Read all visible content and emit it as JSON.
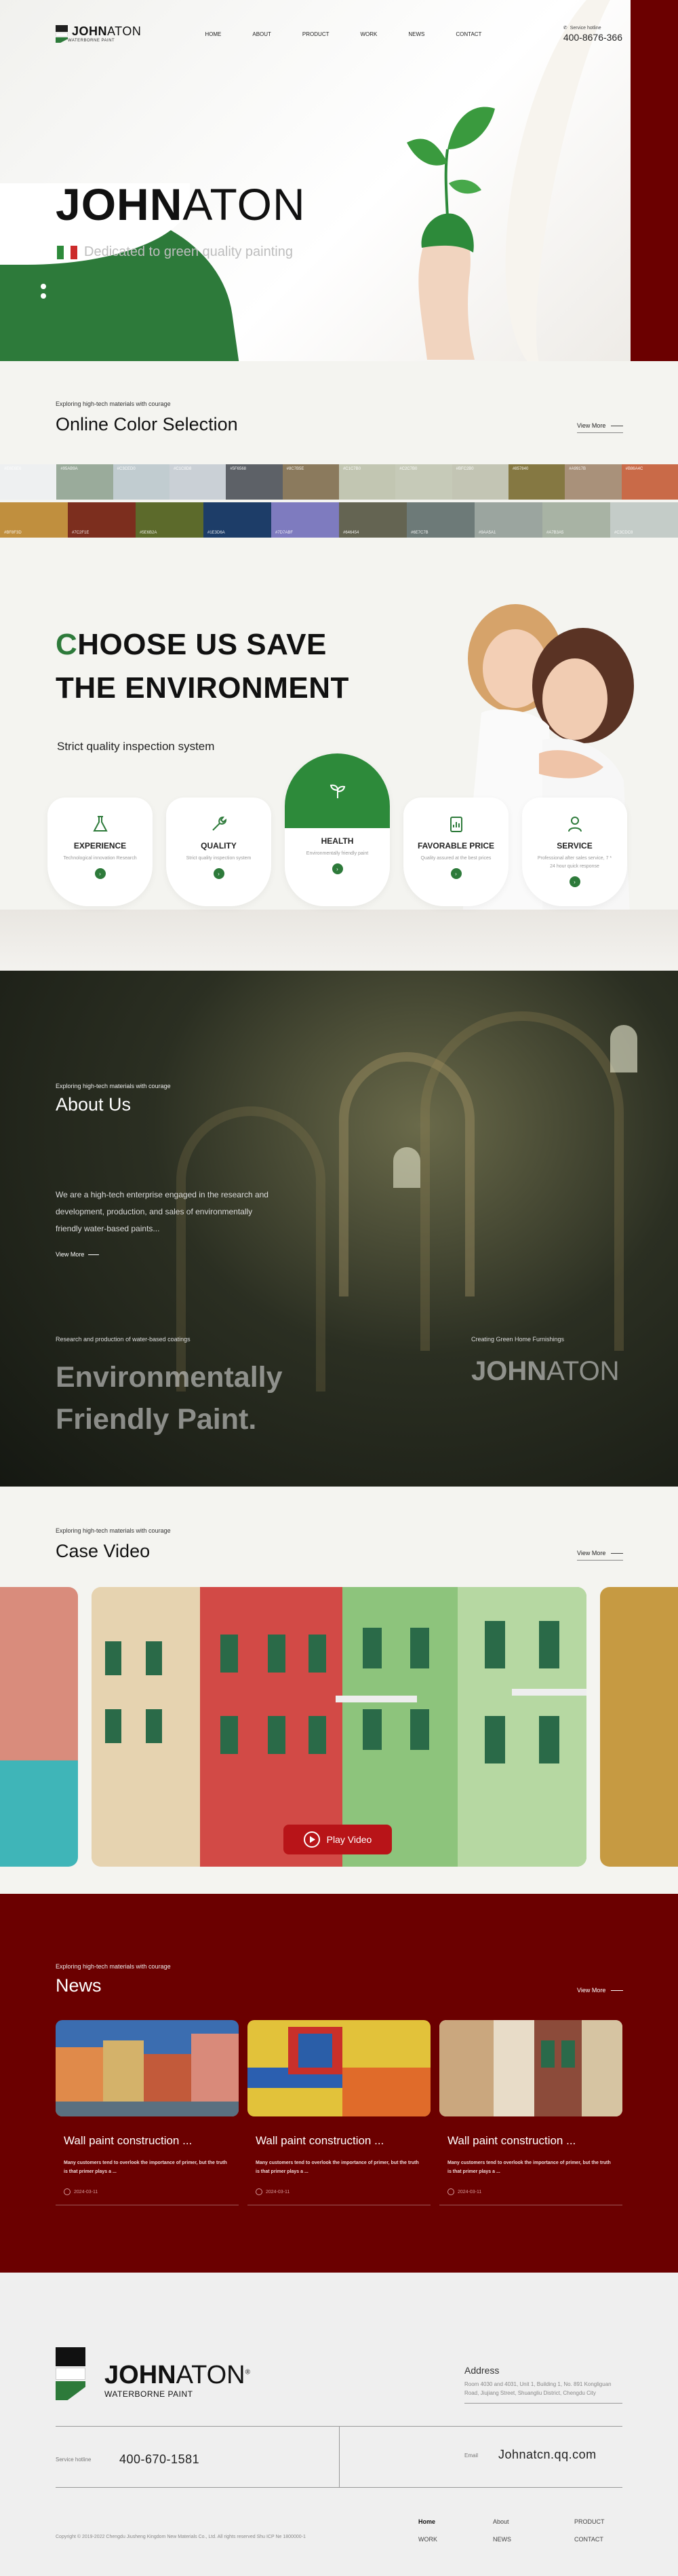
{
  "nav": {
    "brand_bold": "JOHN",
    "brand_light": "ATON",
    "brand_sub": "WATERBORNE PAINT",
    "menu": [
      "HOME",
      "ABOUT",
      "PRODUCT",
      "WORK",
      "NEWS",
      "CONTACT"
    ],
    "hotline_label": "Service hotline",
    "hotline_number": "400-8676-366"
  },
  "hero": {
    "title_bold": "JOHN",
    "title_light": "ATON",
    "subtitle": "Dedicated to green quality painting",
    "flag_colors": [
      "#2d8a3a",
      "#ffffff",
      "#cc2b2b"
    ]
  },
  "colors": {
    "kicker": "Exploring high-tech materials with courage",
    "title": "Online Color Selection",
    "view_more": "View More",
    "row1": [
      {
        "code": "#E6E6E6",
        "hex": "#eef0f1"
      },
      {
        "code": "#95AB9A",
        "hex": "#9aab9b"
      },
      {
        "code": "#C3CED0",
        "hex": "#c1ccd0"
      },
      {
        "code": "#C1C8D8",
        "hex": "#cad0d6"
      },
      {
        "code": "#5F6568",
        "hex": "#5d6167"
      },
      {
        "code": "#8C7B5E",
        "hex": "#8b7a5d"
      },
      {
        "code": "#C1C7B0",
        "hex": "#c2c6b2"
      },
      {
        "code": "#C2C7B0",
        "hex": "#c6cab8"
      },
      {
        "code": "#BFC2B0",
        "hex": "#c3c5b4"
      },
      {
        "code": "#857840",
        "hex": "#857842"
      },
      {
        "code": "#A9917B",
        "hex": "#a9917a"
      },
      {
        "code": "#B86A4C",
        "hex": "#c96a48"
      }
    ],
    "row2": [
      {
        "code": "#BF8F3D",
        "hex": "#c08f3e"
      },
      {
        "code": "#7C2F1E",
        "hex": "#7c2e1e"
      },
      {
        "code": "#5E6B2A",
        "hex": "#5c6a2b"
      },
      {
        "code": "#1E3D6A",
        "hex": "#1d3d68"
      },
      {
        "code": "#7D7ABF",
        "hex": "#7e7bbf"
      },
      {
        "code": "#646454",
        "hex": "#646452"
      },
      {
        "code": "#6E7C7B",
        "hex": "#6d7a78"
      },
      {
        "code": "#9AA5A1",
        "hex": "#9ba59f"
      },
      {
        "code": "#A7B3A5",
        "hex": "#a8b3a4"
      },
      {
        "code": "#C3CDC8",
        "hex": "#c4ccc8"
      }
    ]
  },
  "choose": {
    "title_first_letter": "C",
    "title_line1_rest": "HOOSE US SAVE",
    "title_line2": "THE ENVIRONMENT",
    "subtitle": "Strict quality inspection system",
    "cards": [
      {
        "title": "EXPERIENCE",
        "desc": "Technological innovation Research",
        "icon": "flask-icon"
      },
      {
        "title": "QUALITY",
        "desc": "Strict quality inspection system",
        "icon": "wrench-icon"
      },
      {
        "title": "HEALTH",
        "desc": "Environmentally friendly paint",
        "icon": "sprout-icon"
      },
      {
        "title": "FAVORABLE PRICE",
        "desc": "Quality assured at the best prices",
        "icon": "clipboard-icon"
      },
      {
        "title": "SERVICE",
        "desc": "Professional after sales service, 7 * 24 hour quick response",
        "icon": "user-icon"
      }
    ],
    "accent": "#2d7a3a"
  },
  "about": {
    "kicker": "Exploring high-tech materials with courage",
    "title": "About Us",
    "text": "We are a high-tech enterprise engaged in the research and development, production, and sales of environmentally friendly water-based paints...",
    "view_more": "View More",
    "left_caption": "Research and production of water-based coatings",
    "right_caption": "Creating Green Home Furnishings",
    "big_line1": "Environmentally",
    "big_line2": "Friendly Paint.",
    "logo_bold": "JOHN",
    "logo_light": "ATON"
  },
  "video": {
    "kicker": "Exploring high-tech materials with courage",
    "title": "Case Video",
    "view_more": "View More",
    "play_label": "Play Video"
  },
  "news": {
    "kicker": "Exploring high-tech materials with courage",
    "title": "News",
    "view_more": "View More",
    "items": [
      {
        "title": "Wall paint construction ...",
        "excerpt": "Many customers tend to overlook the importance of primer, but the truth is that primer plays a ...",
        "date": "2024-03-11"
      },
      {
        "title": "Wall paint construction ...",
        "excerpt": "Many customers tend to overlook the importance of primer, but the truth is that primer plays a ...",
        "date": "2024-03-11"
      },
      {
        "title": "Wall paint construction ...",
        "excerpt": "Many customers tend to overlook the importance of primer, but the truth is that primer plays a ...",
        "date": "2024-03-11"
      }
    ]
  },
  "footer": {
    "brand_bold": "JOHN",
    "brand_light": "ATON",
    "brand_sub": "WATERBORNE PAINT",
    "address_label": "Address",
    "address": "Room 4030 and 4031, Unit 1, Building 1, No. 891 Kongliguan Road, Jiujiang Street, Shuangliu District, Chengdu City",
    "hotline_label": "Service hotline",
    "hotline": "400-670-1581",
    "email_label": "Email",
    "email": "Johnatcn.qq.com",
    "copyright": "Copyright © 2019-2022 Chengdu Jiusheng Kingdom New Materials Co., Ltd. All rights reserved Shu ICP Ne 1800000-1",
    "links": [
      "Home",
      "About",
      "PRODUCT",
      "WORK",
      "NEWS",
      "CONTACT"
    ]
  }
}
